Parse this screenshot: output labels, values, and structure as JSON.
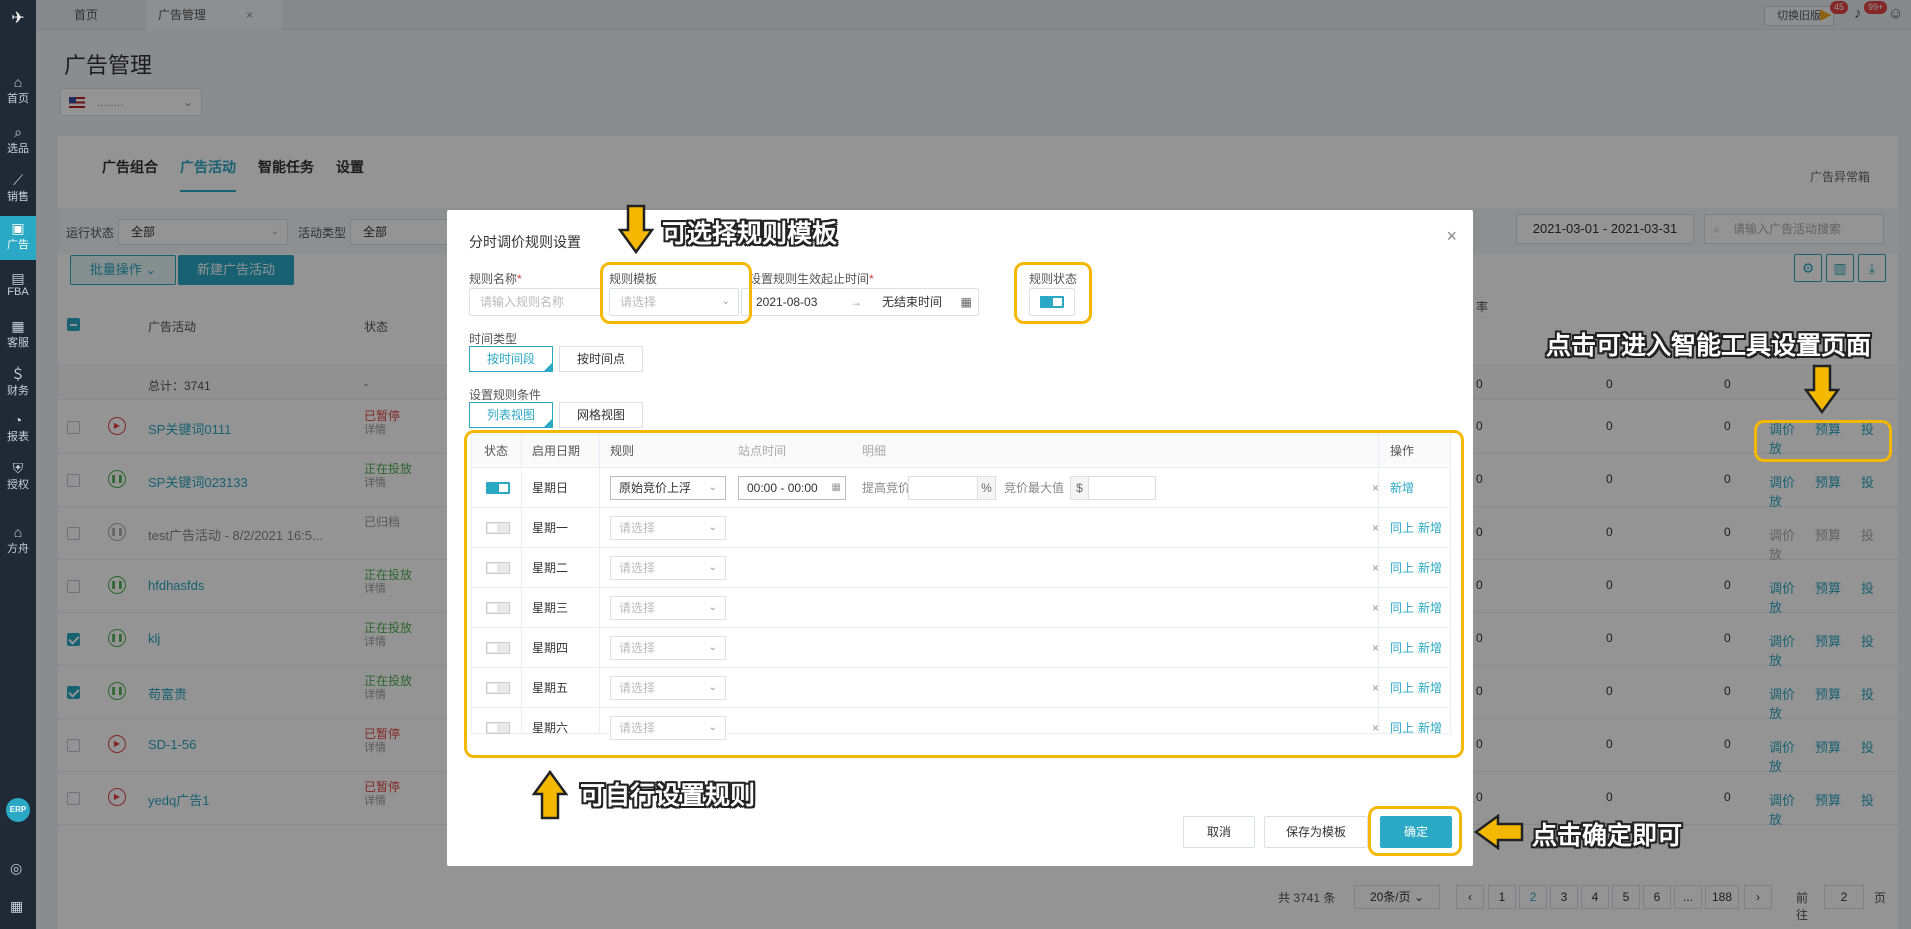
{
  "sidebar": {
    "items": [
      {
        "label": "首页",
        "icon": "home-icon",
        "glyph": "⌂"
      },
      {
        "label": "选品",
        "icon": "search-icon",
        "glyph": "⌕"
      },
      {
        "label": "销售",
        "icon": "chart-icon",
        "glyph": "⟋"
      },
      {
        "label": "广告",
        "icon": "ad-icon",
        "glyph": "▣"
      },
      {
        "label": "FBA",
        "icon": "box-icon",
        "glyph": "▤"
      },
      {
        "label": "客服",
        "icon": "message-icon",
        "glyph": "▦"
      },
      {
        "label": "财务",
        "icon": "finance-icon",
        "glyph": "＄"
      },
      {
        "label": "报表",
        "icon": "report-icon",
        "glyph": "◔"
      },
      {
        "label": "授权",
        "icon": "shield-icon",
        "glyph": "⛨"
      },
      {
        "label": "方舟",
        "icon": "ark-icon",
        "glyph": "⌂"
      }
    ],
    "erp": "ERP"
  },
  "topbar": {
    "tabs": [
      {
        "label": "首页"
      },
      {
        "label": "广告管理",
        "close": "×"
      }
    ],
    "switch_label": "切换旧版",
    "flag_badge": "45",
    "bell_badge": "99+"
  },
  "page": {
    "title": "广告管理",
    "store": "........"
  },
  "content_tabs": [
    "广告组合",
    "广告活动",
    "智能任务",
    "设置"
  ],
  "ad_exception": "广告异常箱",
  "filters": {
    "run_status_label": "运行状态",
    "run_status_value": "全部",
    "activity_type_label": "活动类型",
    "activity_type_value": "全部",
    "date_range": "2021-03-01  -  2021-03-31",
    "search_placeholder": "请输入广告活动搜索"
  },
  "buttons": {
    "batch": "批量操作",
    "new_campaign": "新建广告活动"
  },
  "table": {
    "col_campaign": "广告活动",
    "col_status": "状态",
    "col_rate": "率",
    "total": "总计：3741",
    "total_status": "-",
    "rows": [
      {
        "name": "SP关键词0111",
        "status": "已暂停",
        "detail": "详情",
        "cls": "red",
        "checked": false
      },
      {
        "name": "SP关键词023133",
        "status": "正在投放",
        "detail": "详情",
        "cls": "green",
        "checked": false
      },
      {
        "name": "test广告活动 - 8/2/2021 16:5...",
        "status": "已归档",
        "detail": "",
        "cls": "gray",
        "checked": false
      },
      {
        "name": "hfdhasfds",
        "status": "正在投放",
        "detail": "详情",
        "cls": "green",
        "checked": false
      },
      {
        "name": "klj",
        "status": "正在投放",
        "detail": "详情",
        "cls": "green",
        "checked": true
      },
      {
        "name": "苟富贵",
        "status": "正在投放",
        "detail": "详情",
        "cls": "green",
        "checked": true
      },
      {
        "name": "SD-1-56",
        "status": "已暂停",
        "detail": "详情",
        "cls": "red",
        "checked": false
      },
      {
        "name": "yedq广告1",
        "status": "已暂停",
        "detail": "详情",
        "cls": "red",
        "checked": false
      }
    ],
    "zero": "0",
    "ops": [
      "调价",
      "预算",
      "投放"
    ]
  },
  "pagination": {
    "total": "共 3741 条",
    "page_size": "20条/页",
    "pages": [
      "1",
      "2",
      "3",
      "4",
      "5",
      "6",
      "...",
      "188"
    ],
    "goto_label": "前往",
    "goto_value": "2",
    "page_unit": "页"
  },
  "modal": {
    "title": "分时调价规则设置",
    "rule_name_label": "规则名称",
    "rule_name_placeholder": "请输入规则名称",
    "template_label": "规则模板",
    "template_placeholder": "请选择",
    "effective_label": "设置规则生效起止时间",
    "start_date": "2021-08-03",
    "end_date": "无结束时间",
    "rule_status_label": "规则状态",
    "time_type_label": "时间类型",
    "time_type_options": [
      "按时间段",
      "按时间点"
    ],
    "conditions_label": "设置规则条件",
    "view_options": [
      "列表视图",
      "网格视图"
    ],
    "rule_table": {
      "headers": {
        "status": "状态",
        "day": "启用日期",
        "rule": "规则",
        "site_time": "站点时间",
        "detail": "明细",
        "ops": "操作"
      },
      "rows": [
        {
          "day": "星期日",
          "rule": "原始竞价上浮",
          "time": "00:00 - 00:00",
          "increase_label": "提高竞价",
          "pct": "%",
          "max_label": "竞价最大值",
          "currency": "$",
          "on": true
        },
        {
          "day": "星期一",
          "rule": "请选择",
          "on": false
        },
        {
          "day": "星期二",
          "rule": "请选择",
          "on": false
        },
        {
          "day": "星期三",
          "rule": "请选择",
          "on": false
        },
        {
          "day": "星期四",
          "rule": "请选择",
          "on": false
        },
        {
          "day": "星期五",
          "rule": "请选择",
          "on": false
        },
        {
          "day": "星期六",
          "rule": "请选择",
          "on": false
        }
      ],
      "remove": "×",
      "copy_up": "同上",
      "add": "新增"
    },
    "cancel": "取消",
    "save_template": "保存为模板",
    "confirm": "确定"
  },
  "annotations": {
    "select_template": "可选择规则模板",
    "smart_tool": "点击可进入智能工具设置页面",
    "set_rules": "可自行设置规则",
    "click_confirm": "点击确定即可"
  },
  "colors": {
    "accent": "#2aa8c4",
    "highlight": "#f5b800",
    "danger": "#e34242",
    "success": "#4caf50"
  }
}
